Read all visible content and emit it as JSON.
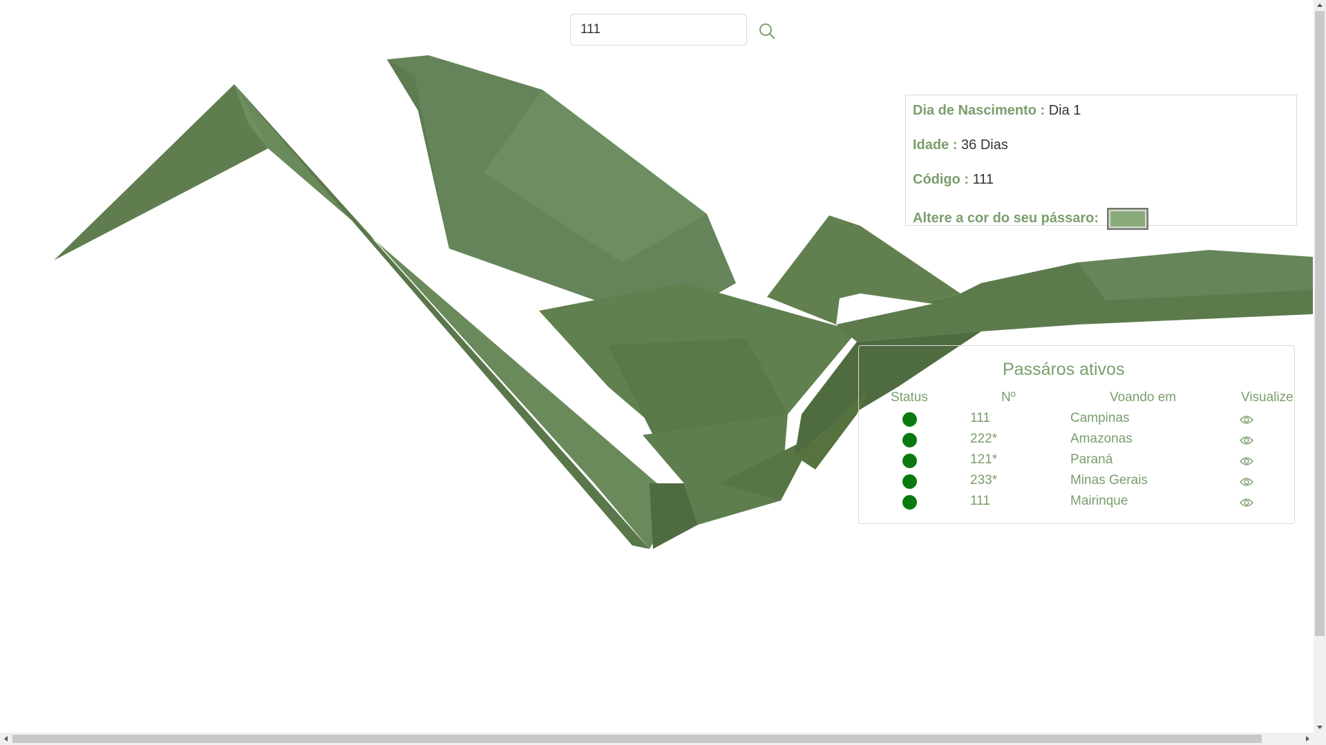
{
  "search": {
    "value": "111"
  },
  "bird_color": "#8aab7a",
  "info": {
    "birth_label": "Dia de Nascimento :",
    "birth_value": "Dia 1",
    "age_label": "Idade :",
    "age_value": "36 Dias",
    "code_label": "Código :",
    "code_value": "111",
    "color_label": "Altere a cor do seu pássaro:"
  },
  "active_birds": {
    "title": "Passáros ativos",
    "columns": [
      "Status",
      "Nº",
      "Voando em",
      "Visualize"
    ],
    "rows": [
      {
        "number": "111",
        "city": "Campinas",
        "status_color": "#0a7a10"
      },
      {
        "number": "222*",
        "city": "Amazonas",
        "status_color": "#0a7a10"
      },
      {
        "number": "121*",
        "city": "Paraná",
        "status_color": "#0a7a10"
      },
      {
        "number": "233*",
        "city": "Minas Gerais",
        "status_color": "#0a7a10"
      },
      {
        "number": "111",
        "city": "Mairinque",
        "status_color": "#0a7a10"
      }
    ]
  }
}
